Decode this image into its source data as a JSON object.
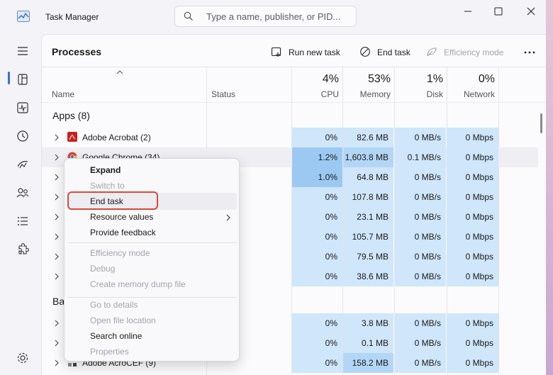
{
  "window": {
    "title": "Task Manager",
    "search_placeholder": "Type a name, publisher, or PID..."
  },
  "toolbar": {
    "page_title": "Processes",
    "run_new_task": "Run new task",
    "end_task": "End task",
    "efficiency_mode": "Efficiency mode"
  },
  "columns": {
    "name": "Name",
    "status": "Status",
    "cpu_pct": "4%",
    "cpu": "CPU",
    "memory_pct": "53%",
    "memory": "Memory",
    "disk_pct": "1%",
    "disk": "Disk",
    "network_pct": "0%",
    "network": "Network"
  },
  "sections": {
    "apps": "Apps (8)",
    "background": "Ba"
  },
  "rows": [
    {
      "name": "Adobe Acrobat (2)",
      "cpu": "0%",
      "memory": "82.6 MB",
      "disk": "0 MB/s",
      "network": "0 Mbps"
    },
    {
      "name": "Google Chrome (34)",
      "cpu": "1.2%",
      "memory": "1,603.8 MB",
      "disk": "0.1 MB/s",
      "network": "0 Mbps"
    },
    {
      "name": "",
      "cpu": "1.0%",
      "memory": "64.8 MB",
      "disk": "0 MB/s",
      "network": "0 Mbps"
    },
    {
      "name": "",
      "cpu": "0%",
      "memory": "107.8 MB",
      "disk": "0 MB/s",
      "network": "0 Mbps"
    },
    {
      "name": "",
      "cpu": "0%",
      "memory": "23.1 MB",
      "disk": "0 MB/s",
      "network": "0 Mbps"
    },
    {
      "name": "",
      "cpu": "0%",
      "memory": "105.7 MB",
      "disk": "0 MB/s",
      "network": "0 Mbps"
    },
    {
      "name": "",
      "cpu": "0%",
      "memory": "79.5 MB",
      "disk": "0 MB/s",
      "network": "0 Mbps"
    },
    {
      "name": "",
      "cpu": "0%",
      "memory": "38.6 MB",
      "disk": "0 MB/s",
      "network": "0 Mbps"
    },
    {
      "name": "",
      "cpu": "0%",
      "memory": "3.8 MB",
      "disk": "0 MB/s",
      "network": "0 Mbps"
    },
    {
      "name": "",
      "cpu": "0%",
      "memory": "0.1 MB",
      "disk": "0 MB/s",
      "network": "0 Mbps"
    },
    {
      "name": "Adobe AcroCEF (9)",
      "cpu": "0%",
      "memory": "158.2 MB",
      "disk": "0 MB/s",
      "network": "0 Mbps"
    }
  ],
  "context_menu": {
    "expand": "Expand",
    "switch_to": "Switch to",
    "end_task": "End task",
    "resource_values": "Resource values",
    "provide_feedback": "Provide feedback",
    "efficiency_mode": "Efficiency mode",
    "debug": "Debug",
    "create_dump": "Create memory dump file",
    "go_to_details": "Go to details",
    "open_file_location": "Open file location",
    "search_online": "Search online",
    "properties": "Properties"
  },
  "colors": {
    "heat_light": "#cfe6fb",
    "heat_mid": "#b3d6f6",
    "heat_strong": "#9cc9f2",
    "accent": "#3b6fd4",
    "highlight_outline": "#d94a3a"
  }
}
